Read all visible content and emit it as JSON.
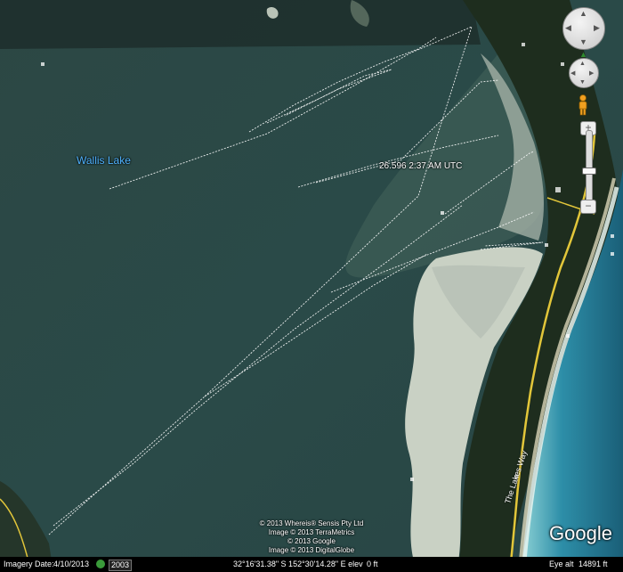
{
  "map": {
    "lake_label": "Wallis Lake",
    "track_label": "26.596 2:37 AM UTC",
    "road_label": "The Lakes Way"
  },
  "attribution": [
    "© 2013 Whereis® Sensis Pty Ltd",
    "Image © 2013 TerraMetrics",
    "© 2013 Google",
    "Image © 2013 DigitalGlobe"
  ],
  "logo": "Google",
  "status": {
    "imagery_date_label": "Imagery Date:",
    "imagery_date": "4/10/2013",
    "year": "2003",
    "coordinates": "32°16'31.38\" S  152°30'14.28\" E  elev",
    "elevation": "0 ft",
    "eye_alt_label": "Eye alt",
    "eye_alt": "14891 ft"
  },
  "nav": {
    "zoom_in": "+",
    "zoom_out": "−"
  },
  "colors": {
    "lake": "#2a4a48",
    "sand": "#c9d1c4",
    "forest": "#1e2d1e",
    "ocean": "#1f6f8a",
    "surf": "#7ec8cf",
    "road": "#e2c63a",
    "label": "#4fb3ff",
    "track": "#ffffff"
  }
}
